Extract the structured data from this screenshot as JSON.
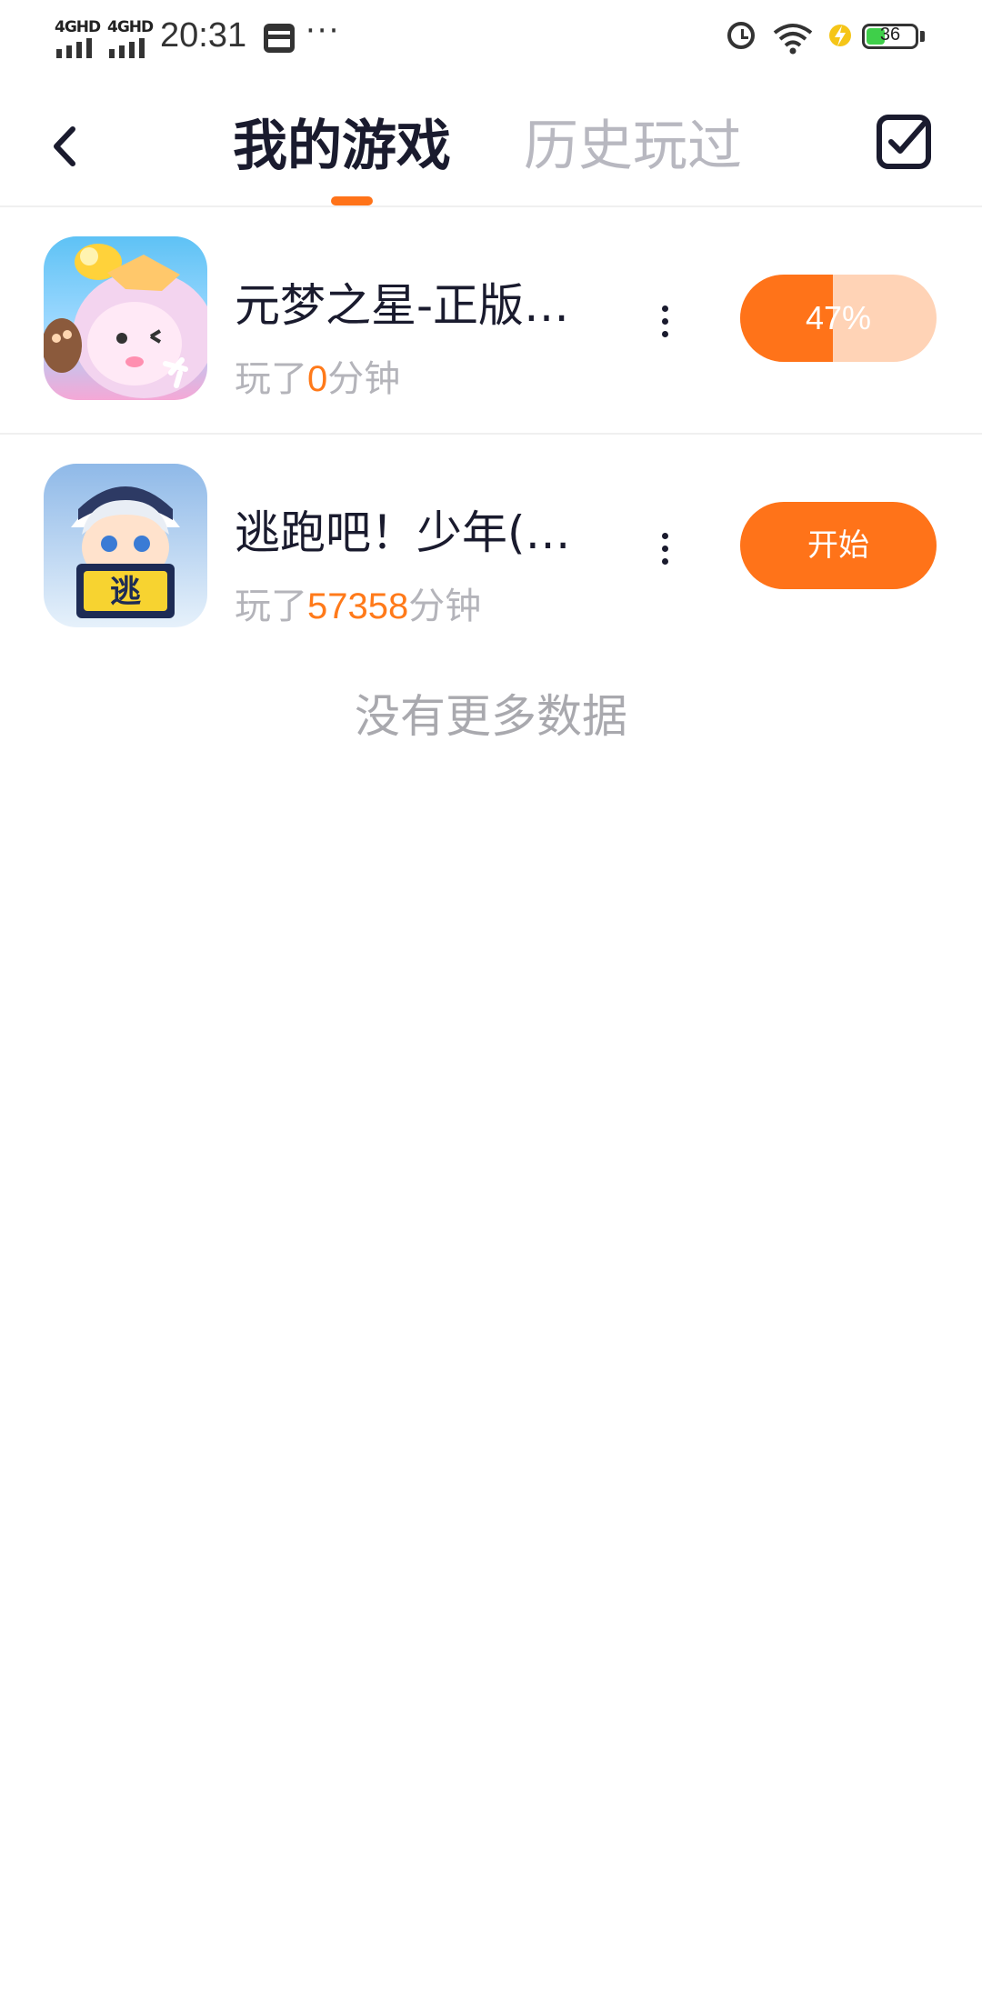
{
  "status_bar": {
    "network_1": "4GHD",
    "network_2": "4GHD",
    "time": "20:31",
    "more": "···",
    "battery_level": "36"
  },
  "header": {
    "tab_active": "我的游戏",
    "tab_inactive": "历史玩过"
  },
  "games": [
    {
      "title": "元梦之星-正版…",
      "played_prefix": "玩了",
      "played_value": "0",
      "played_suffix": "分钟",
      "action_label": "47%",
      "progress": 0.47
    },
    {
      "title": "逃跑吧！少年(…",
      "played_prefix": "玩了",
      "played_value": "57358",
      "played_suffix": "分钟",
      "action_label": "开始"
    }
  ],
  "end_message": "没有更多数据",
  "colors": {
    "accent": "#ff7319",
    "accent_light": "#ffd3b6",
    "text_dark": "#1a1b2e",
    "text_gray": "#b4b4ba"
  }
}
